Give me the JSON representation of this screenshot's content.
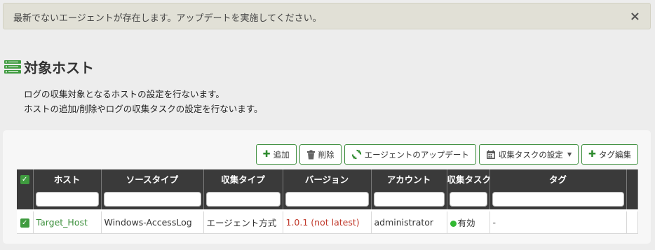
{
  "alert": {
    "message": "最新でないエージェントが存在します。アップデートを実施してください。",
    "close": "×"
  },
  "page": {
    "title": "対象ホスト",
    "desc1": "ログの収集対象となるホストの設定を行ないます。",
    "desc2": "ホストの追加/削除やログの収集タスクの設定を行ないます。"
  },
  "toolbar": {
    "add": "追加",
    "delete": "削除",
    "update": "エージェントのアップデート",
    "task": "収集タスクの設定",
    "tag_edit": "タグ編集"
  },
  "table": {
    "headers": [
      "ホスト",
      "ソースタイプ",
      "収集タイプ",
      "バージョン",
      "アカウント",
      "収集タスク",
      "タグ"
    ],
    "rows": [
      {
        "host": "Target_Host",
        "source_type": "Windows-AccessLog",
        "collect_type": "エージェント方式",
        "version": "1.0.1 (not latest)",
        "account": "administrator",
        "task": "有効",
        "tag": "-"
      }
    ]
  },
  "colors": {
    "accent": "#3f9b3f",
    "header_bg": "#3a3a3a",
    "warning_text": "#c0392b"
  }
}
